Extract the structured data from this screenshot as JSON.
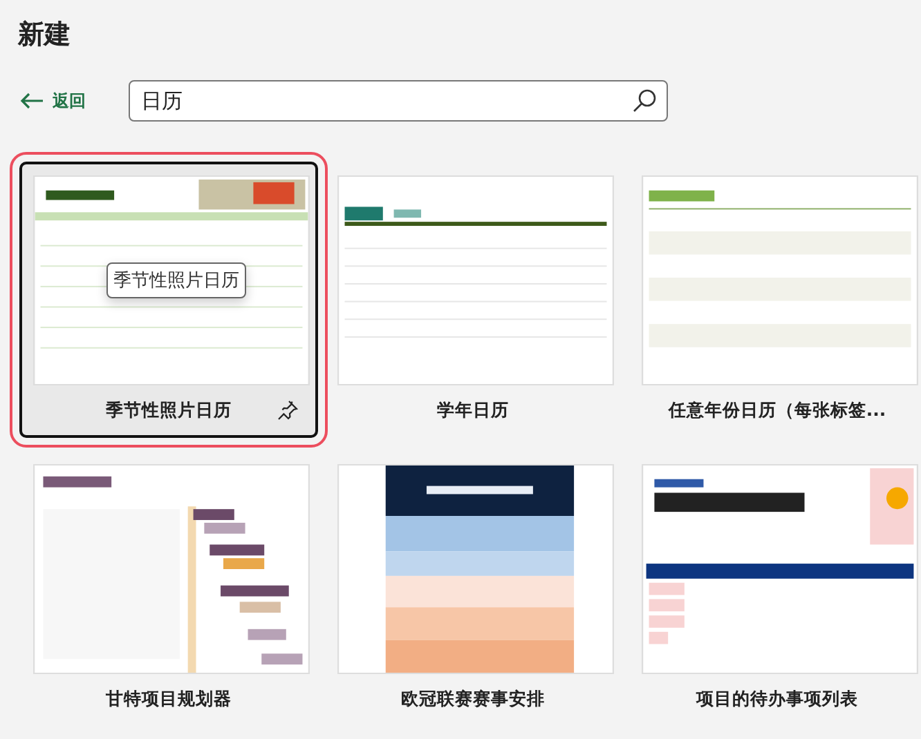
{
  "title": "新建",
  "back": {
    "label": "返回"
  },
  "search": {
    "value": "日历"
  },
  "templates": [
    {
      "name": "季节性照片日历",
      "kind": "seasonal",
      "selected": true
    },
    {
      "name": "学年日历",
      "kind": "academic",
      "selected": false
    },
    {
      "name": "任意年份日历（每张标签...",
      "kind": "yearly",
      "selected": false
    },
    {
      "name": "甘特项目规划器",
      "kind": "gantt",
      "selected": false
    },
    {
      "name": "欧冠联赛赛事安排",
      "kind": "league",
      "selected": false
    },
    {
      "name": "项目的待办事项列表",
      "kind": "todo",
      "selected": false
    }
  ],
  "tooltip": "季节性照片日历"
}
